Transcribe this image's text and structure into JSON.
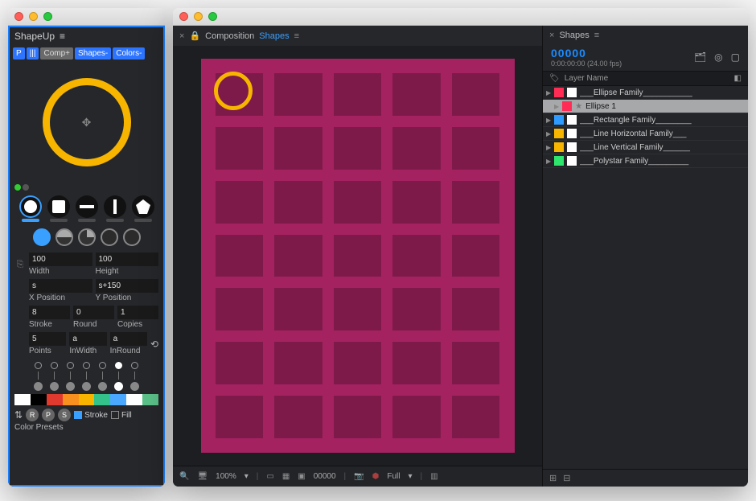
{
  "shapeup": {
    "title": "ShapeUp",
    "toggles": [
      {
        "label": "P",
        "style": "blue"
      },
      {
        "label": "|||",
        "style": "blue"
      },
      {
        "label": "Comp+",
        "style": "grey"
      },
      {
        "label": "Shapes-",
        "style": "blue"
      },
      {
        "label": "Colors-",
        "style": "blue"
      }
    ],
    "shapes": [
      "circle",
      "square",
      "line-h",
      "line-v",
      "polygon"
    ],
    "selected_shape": 0,
    "fields": {
      "width": {
        "value": "100",
        "label": "Width"
      },
      "height": {
        "value": "100",
        "label": "Height"
      },
      "xpos": {
        "value": "s",
        "label": "X Position"
      },
      "ypos": {
        "value": "s+150",
        "label": "Y Position"
      },
      "stroke": {
        "value": "8",
        "label": "Stroke"
      },
      "round": {
        "value": "0",
        "label": "Round"
      },
      "copies": {
        "value": "1",
        "label": "Copies"
      },
      "points": {
        "value": "5",
        "label": "Points"
      },
      "inwidth": {
        "value": "a",
        "label": "InWidth"
      },
      "inround": {
        "value": "a",
        "label": "InRound"
      }
    },
    "swatches": [
      "#ffffff",
      "#000000",
      "#e03a2f",
      "#f7901e",
      "#f7b500",
      "#34c28b",
      "#4aa8ff",
      "#ffffff",
      "#5bc189"
    ],
    "rbuttons": [
      "R",
      "P",
      "S"
    ],
    "stroke_label": "Stroke",
    "fill_label": "Fill",
    "presets_label": "Color Presets"
  },
  "composition": {
    "header_prefix": "Composition",
    "header_title": "Shapes",
    "footer": {
      "zoom": "100%",
      "zoom_arrow": "▾",
      "time": "00000",
      "res": "Full",
      "res_arrow": "▾"
    }
  },
  "layers_panel": {
    "title": "Shapes",
    "timecode": "00000",
    "timecode_sub": "0:00:00:00 (24.00 fps)",
    "col_header": "Layer Name",
    "layers": [
      {
        "color": "#ff2d55",
        "name": "___Ellipse Family___________",
        "selected": false,
        "indent": false,
        "star": false
      },
      {
        "color": "#ff2d55",
        "name": "Ellipse 1",
        "selected": true,
        "indent": true,
        "star": true
      },
      {
        "color": "#2d9bff",
        "name": "___Rectangle Family________",
        "selected": false,
        "indent": false,
        "star": false
      },
      {
        "color": "#f7b500",
        "name": "___Line Horizontal Family___",
        "selected": false,
        "indent": false,
        "star": false
      },
      {
        "color": "#f7b500",
        "name": "___Line Vertical Family______",
        "selected": false,
        "indent": false,
        "star": false
      },
      {
        "color": "#2ee66b",
        "name": "___Polystar Family_________",
        "selected": false,
        "indent": false,
        "star": false
      }
    ]
  }
}
